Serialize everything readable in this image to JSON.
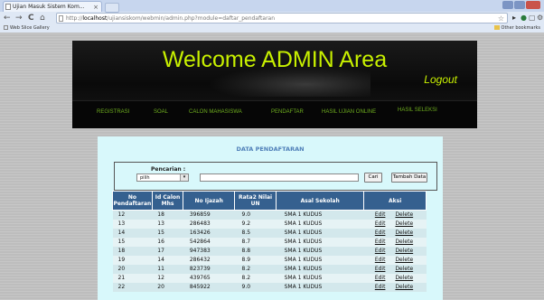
{
  "browser": {
    "tab_title": "Ujian Masuk Sistem Kom...",
    "tab_close": "×",
    "url_host": "localhost",
    "url_path": "/ujiansiskom/webmin/admin.php?module=daftar_pendaftaran",
    "url_prefix": "http://",
    "bookmarks_left": "Web Slice Gallery",
    "bookmarks_right": "Other bookmarks",
    "nav_back": "←",
    "nav_forward": "→",
    "nav_reload": "C",
    "nav_home": "⌂",
    "star": "☆"
  },
  "header": {
    "welcome": "Welcome ADMIN Area",
    "logout": "Logout"
  },
  "menu": [
    "REGISTRASI",
    "SOAL",
    "CALON MAHASISWA",
    "PENDAFTAR",
    "HASIL UJIAN ONLINE",
    "HASIL SELEKSI"
  ],
  "content": {
    "title": "DATA PENDAFTARAN",
    "search_label": "Pencarian :",
    "select_value": "pilih",
    "cari_button": "Cari",
    "tambah_button": "Tambah Data"
  },
  "table": {
    "headers": [
      "No Pendaftaran",
      "Id Calon Mhs",
      "No Ijazah",
      "Rata2 Nilai UN",
      "Asal Sekolah",
      "Aksi"
    ],
    "edit_label": "Edit",
    "delete_label": "Delete",
    "rows": [
      [
        "12",
        "18",
        "396859",
        "9.0",
        "SMA 1 KUDUS"
      ],
      [
        "13",
        "13",
        "286483",
        "9.2",
        "SMA 1 KUDUS"
      ],
      [
        "14",
        "15",
        "163426",
        "8.5",
        "SMA 1 KUDUS"
      ],
      [
        "15",
        "16",
        "542864",
        "8.7",
        "SMA 1 KUDUS"
      ],
      [
        "18",
        "17",
        "947383",
        "8.8",
        "SMA 1 KUDUS"
      ],
      [
        "19",
        "14",
        "286432",
        "8.9",
        "SMA 1 KUDUS"
      ],
      [
        "20",
        "11",
        "823739",
        "8.2",
        "SMA 1 KUDUS"
      ],
      [
        "21",
        "12",
        "439765",
        "8.2",
        "SMA 1 KUDUS"
      ],
      [
        "22",
        "20",
        "845922",
        "9.0",
        "SMA 1 KUDUS"
      ]
    ]
  }
}
